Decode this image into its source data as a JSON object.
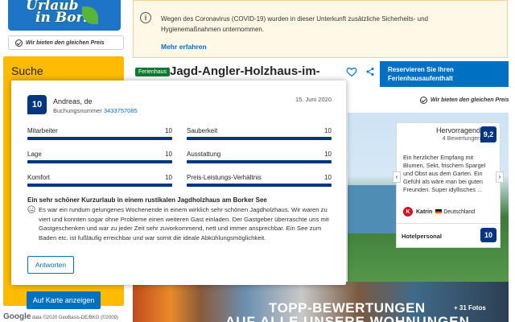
{
  "brand": {
    "logo_line1": "Urlaub",
    "logo_line2": "in Bork",
    "price_guarantee": "Wir bieten den gleichen Preis"
  },
  "search": {
    "title": "Suche",
    "map_button": "Auf Karte anzeigen"
  },
  "map": {
    "google_label": "Google",
    "attribution": "data ©2020 GeoBasis-DE/BKG (©2009)"
  },
  "notice": {
    "text": "Wegen des Coronavirus (COVID-19) wurden in dieser Unterkunft zusätzliche Sicherheits- und Hygienemaßnahmen unternommen.",
    "link": "Mehr erfahren"
  },
  "property": {
    "type_badge": "Ferienhaus",
    "title": "Jagd-Angler-Holzhaus-im-",
    "reserve_button": "Reservieren Sie Ihren Ferienhausaufenthalt",
    "price_guarantee": "Wir bieten den gleichen Preis"
  },
  "review_panel": {
    "label": "Hervorragend",
    "count": "4 Bewertungen",
    "score": "9,2",
    "quote": "Ein herzlicher Empfang mit Blumen, Sekt, frischem Spargel und Obst aus dem Garten. Ein Gefühl als wäre man bei guten Freunden. Super idyllisches ...",
    "author_initial": "K",
    "author_name": "Katrin",
    "author_country": "Deutschland",
    "staff_label": "Hotelpersonal",
    "staff_score": "10",
    "left_arrow": "‹",
    "right_arrow": "›"
  },
  "gallery": {
    "banner_line1": "TOPP-BEWERTUNGEN",
    "banner_line2": "AUF ALLE UNSERE WOHNUNGEN",
    "photos_count": "+ 31 Fotos"
  },
  "review_modal": {
    "score": "10",
    "reviewer": "Andreas, de",
    "booking_label": "Buchungsnummer",
    "booking_number": "3433757085",
    "date": "15. Juni 2020",
    "scores": [
      {
        "name": "Mitarbeiter",
        "value": "10",
        "fraction": 1.0
      },
      {
        "name": "Sauberkeit",
        "value": "10",
        "fraction": 1.0
      },
      {
        "name": "Lage",
        "value": "10",
        "fraction": 1.0
      },
      {
        "name": "Ausstattung",
        "value": "10",
        "fraction": 1.0
      },
      {
        "name": "Komfort",
        "value": "10",
        "fraction": 1.0
      },
      {
        "name": "Preis-Leistungs-Verhältnis",
        "value": "10",
        "fraction": 1.0
      }
    ],
    "title": "Ein sehr schöner Kurzurlaub in einem rustikalen Jagdholzhaus am Borker See",
    "body": "Es war ein rundum gelungenes Wochenende in einem wirklich sehr schönen Jagdholzhaus. Wir waren zu viert und konnten sogar ohne Probleme einen weiteren Gast einladen. Der Gastgeber überraschte uns mit Gastgeschenken und war zu jeder Zeit sehr zuvorkommend, nett und immer ansprechbar. Ein See zum Baden etc. ist fußläufig erreichbar und war somit die ideale Abkühlungsmöglichkeit.",
    "reply_button": "Antworten"
  },
  "colors": {
    "brand_blue": "#003580",
    "link_blue": "#0071c2",
    "search_yellow": "#febb02",
    "badge_green": "#0f7a2f"
  }
}
